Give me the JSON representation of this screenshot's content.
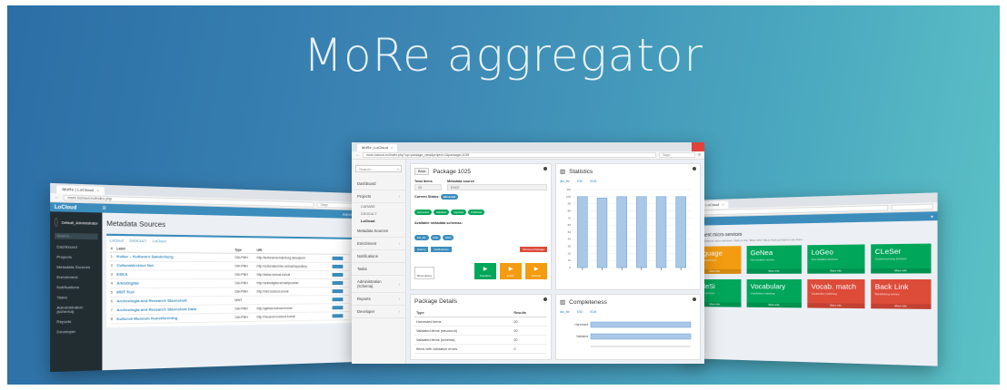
{
  "headline": "MoRe aggregator",
  "left_window": {
    "tab_title": "MoRe | LoCloud",
    "url": "more.locloud.eu/index.php",
    "search_placeholder": "Søgn",
    "app_logo": "LoCloud",
    "user": "Admin",
    "side_user": "Default_Administrator",
    "side_search": "Search...",
    "sidebar": [
      "Dashboard",
      "Projects",
      "Metadata Sources",
      "Enrichment",
      "Notifications",
      "Tasks",
      "Administration (schema)",
      "Reports",
      "Developer"
    ],
    "page_title": "Metadata Sources",
    "subtabs": [
      "LoCloud",
      "DIGICULT",
      "LoCloud"
    ],
    "table_headers": [
      "#",
      "Label",
      "Type",
      "URI"
    ],
    "rows": [
      {
        "n": "1",
        "label": "Kultur – Kulturarv Sønderborg",
        "type": "OAI-PMH",
        "uri": "http://kulturarvsonderborg.dk/oaipmh"
      },
      {
        "n": "2",
        "label": "CulturalArchive Net",
        "type": "OAI-PMH",
        "uri": "http://culturalarchive.net/oai/repository"
      },
      {
        "n": "3",
        "label": "ESKA",
        "type": "OAI-PMH",
        "uri": "http://eska.locloud.eu/oai"
      },
      {
        "n": "4",
        "label": "ArkivDigital",
        "type": "OAI-PMH",
        "uri": "http://arkivdigital.se/oai/provider"
      },
      {
        "n": "5",
        "label": "MNT Test",
        "type": "OAI-PMH",
        "uri": "http://mnt.locloud.eu/oai"
      },
      {
        "n": "6",
        "label": "Archeologia and Research Stavnsholt",
        "type": "MINT",
        "uri": ""
      },
      {
        "n": "7",
        "label": "Archeologia and Research Stavnsholt Data",
        "type": "OAI-PMH",
        "uri": "http://galicia.locloud.eu/oai"
      },
      {
        "n": "8",
        "label": "Kultursk Museum Kunstforening",
        "type": "OAI-PMH",
        "uri": "http://museum.locloud.eu/oai"
      }
    ]
  },
  "center_window": {
    "tab_title": "MoRe | LoCloud",
    "url": "more.locloud.eu/index.php?op=package_view&project=1&package=1025",
    "search_placeholder": "Søgn",
    "side_search": "Search...",
    "sidebar": [
      {
        "label": "Dashboard",
        "caret": ""
      },
      {
        "label": "Projects",
        "caret": "‹"
      }
    ],
    "projects_sub": [
      "CARARE",
      "DIGICULT",
      "LoCloud"
    ],
    "sidebar_rest": [
      {
        "label": "Metadata Sources",
        "caret": ""
      },
      {
        "label": "Enrichment",
        "caret": "‹"
      },
      {
        "label": "Notifications",
        "caret": ""
      },
      {
        "label": "Tasks",
        "caret": ""
      },
      {
        "label": "Administration (schema)",
        "caret": "‹"
      },
      {
        "label": "Reports",
        "caret": "‹"
      },
      {
        "label": "Developer",
        "caret": "‹"
      }
    ],
    "package": {
      "back_label": "Back",
      "title": "Package 1025",
      "total_items_label": "Total items",
      "total_items_value": "20",
      "metadata_source_label": "Metadata source",
      "metadata_source_value": "ESCE",
      "current_status_label": "Current Status:",
      "current_status_badge": "Harvested",
      "status_pills": [
        "Harvested",
        "Validated",
        "Ingested",
        "Published"
      ],
      "schemas_label": "Available metadata schemas:",
      "schemas": [
        "lido_lite",
        "ESE",
        "EDM"
      ],
      "small_buttons": [
        "History",
        "Notifications"
      ],
      "danger_button": "Remove Package",
      "history_label": "Show History",
      "actions": [
        "Transform",
        "Enrich",
        "Harvest"
      ]
    },
    "details": {
      "title": "Package Details",
      "headers": [
        "Type",
        "Results"
      ],
      "rows": [
        {
          "type": "Harvested items",
          "result": "20"
        },
        {
          "type": "Validated items (structural)",
          "result": "20"
        },
        {
          "type": "Validated items (schema)",
          "result": "20"
        },
        {
          "type": "Items with validation errors",
          "result": "0"
        }
      ]
    },
    "statistics": {
      "title": "Statistics",
      "legend": [
        "lido_lite",
        "ESE",
        "EDM"
      ]
    },
    "completeness": {
      "title": "Completeness",
      "legend": [
        "lido_lite",
        "ESE",
        "EDM"
      ],
      "y_labels": [
        "Harvested",
        "Validated"
      ]
    }
  },
  "right_window": {
    "tab_title": "MoRe | LoCloud",
    "page_title": "Enrichment micro-services",
    "subtitle": "Available enrichment micro-services. Click on the \"More info\" link to find out how to use them.",
    "tiles": [
      {
        "name": "Language",
        "sub": "Language enrichment",
        "color": "#f39c12"
      },
      {
        "name": "GeNea",
        "sub": "Geo-location service",
        "color": "#00a65a"
      },
      {
        "name": "LoGeo",
        "sub": "Geo-location services",
        "color": "#00a65a"
      },
      {
        "name": "CLeSer",
        "sub": "Crowd-sourcing services",
        "color": "#00a65a"
      },
      {
        "name": "BeNeSi",
        "sub": "Vocabulary services",
        "color": "#00a65a"
      },
      {
        "name": "Vocabulary",
        "sub": "Vocabulary matching",
        "color": "#00a65a"
      },
      {
        "name": "Vocab. match",
        "sub": "Vocabulary matching",
        "color": "#dd4b39"
      },
      {
        "name": "Back Link",
        "sub": "Backlinking service",
        "color": "#dd4b39"
      }
    ],
    "more_info": "More info"
  },
  "chart_data": [
    {
      "type": "bar",
      "title": "Statistics",
      "series": [
        {
          "name": "lido_lite",
          "values": [
            100,
            98,
            100,
            100,
            100,
            100
          ]
        }
      ],
      "categories": [
        "",
        "",
        "",
        "",
        "",
        ""
      ],
      "ylim": [
        0,
        110
      ],
      "y_ticks": [
        "110",
        "100",
        "90",
        "80",
        "70",
        "60",
        "50",
        "40",
        "30",
        "20",
        "10",
        "0"
      ]
    },
    {
      "type": "bar",
      "title": "Completeness",
      "categories": [
        "Harvested",
        "Validated"
      ],
      "series": [
        {
          "name": "lido_lite",
          "values": [
            100,
            100
          ]
        }
      ],
      "xlim": [
        0,
        100
      ]
    }
  ]
}
